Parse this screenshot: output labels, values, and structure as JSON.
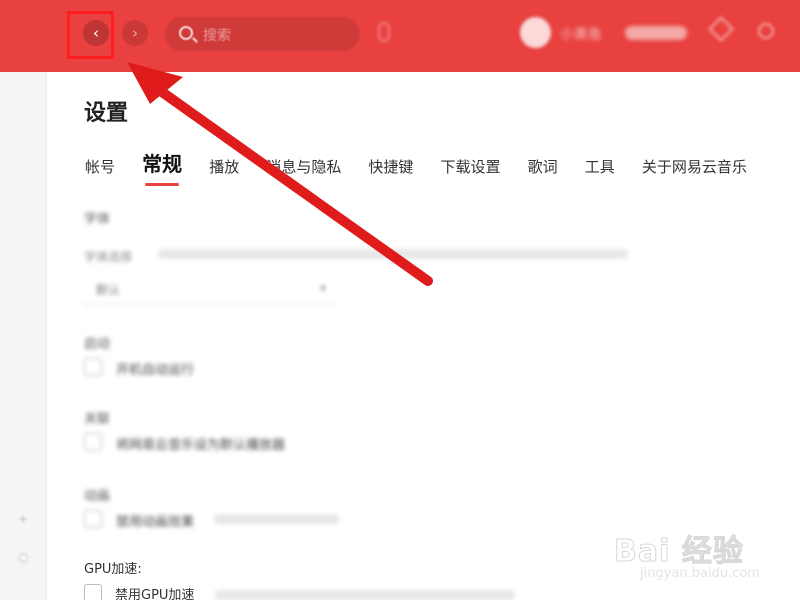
{
  "header": {
    "back_glyph": "‹",
    "forward_glyph": "›",
    "search_placeholder": "搜索",
    "username": "小黄鱼"
  },
  "sidebar": {
    "icons": [
      "plus-icon",
      "more-icon"
    ]
  },
  "page": {
    "title": "设置",
    "tabs": [
      {
        "label": "帐号",
        "active": false
      },
      {
        "label": "常规",
        "active": true
      },
      {
        "label": "播放",
        "active": false
      },
      {
        "label": "消息与隐私",
        "active": false
      },
      {
        "label": "快捷键",
        "active": false
      },
      {
        "label": "下载设置",
        "active": false
      },
      {
        "label": "歌词",
        "active": false
      },
      {
        "label": "工具",
        "active": false
      },
      {
        "label": "关于网易云音乐",
        "active": false
      }
    ]
  },
  "general": {
    "font_section": "字体",
    "font_desc": "字体选择",
    "font_value": "默认",
    "startup_section": "启动",
    "startup_option": "开机自动运行",
    "close_section": "关联",
    "close_option": "将网易云音乐设为默认播放器",
    "anim_section": "动画",
    "anim_option": "禁用动画效果",
    "gpu_section": "GPU加速:",
    "gpu_option": "禁用GPU加速"
  },
  "watermark": {
    "text": "Bai 经验",
    "url": "jingyan.baidu.com"
  },
  "colors": {
    "brand_red": "#e8413f",
    "highlight": "#ff1e1e"
  }
}
